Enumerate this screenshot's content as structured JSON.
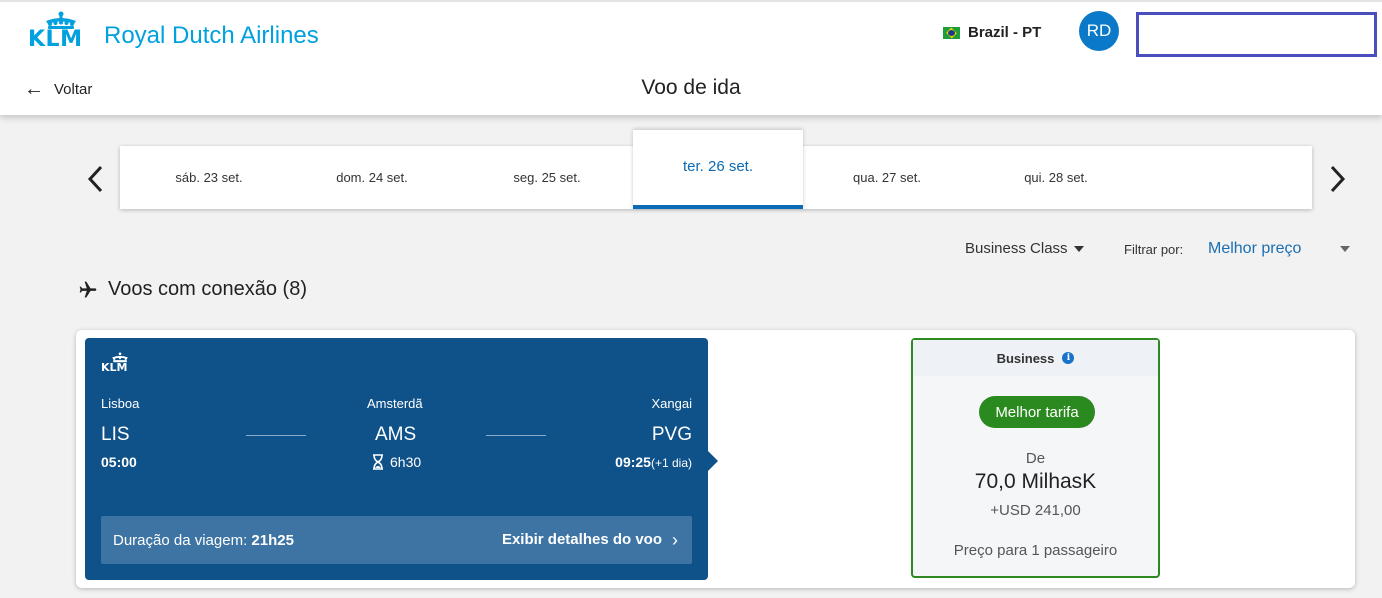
{
  "header": {
    "brand_short": "KLM",
    "brand_name": "Royal Dutch Airlines",
    "locale": "Brazil - PT",
    "avatar_initials": "RD",
    "back_label": "Voltar",
    "page_title": "Voo de ida"
  },
  "dates": [
    {
      "label": "sáb. 23 set.",
      "active": false
    },
    {
      "label": "dom. 24 set.",
      "active": false
    },
    {
      "label": "seg. 25 set.",
      "active": false
    },
    {
      "label": "ter. 26 set.",
      "active": true
    },
    {
      "label": "qua. 27 set.",
      "active": false
    },
    {
      "label": "qui. 28 set.",
      "active": false
    }
  ],
  "filters": {
    "cabin_class": "Business Class",
    "filter_label": "Filtrar por:",
    "filter_value": "Melhor preço"
  },
  "section": {
    "title": "Voos com conexão (8)"
  },
  "flight": {
    "carrier": "KLM",
    "origin": {
      "city": "Lisboa",
      "code": "LIS",
      "time": "05:00"
    },
    "stop": {
      "city": "Amsterdã",
      "code": "AMS",
      "layover": "6h30"
    },
    "destination": {
      "city": "Xangai",
      "code": "PVG",
      "time": "09:25",
      "day_offset": "(+1 dia)"
    },
    "duration_label": "Duração da viagem:",
    "duration_value": "21h25",
    "details_label": "Exibir detalhes do voo"
  },
  "fare": {
    "cabin": "Business",
    "badge": "Melhor tarifa",
    "from_label": "De",
    "miles": "70,0 MilhasK",
    "usd": "+USD 241,00",
    "note": "Preço para 1 passageiro"
  },
  "colors": {
    "brand_blue": "#00a1de",
    "itinerary_bg": "#0f5189",
    "active_date": "#0a6ab3",
    "best_fare_green": "#2b8a1f",
    "avatar_bg": "#0a79c8"
  }
}
